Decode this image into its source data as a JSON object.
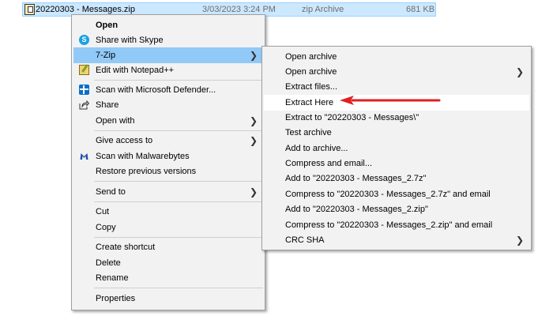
{
  "file": {
    "name": "20220303 - Messages.zip",
    "date": "3/03/2023 3:24 PM",
    "type": "zip Archive",
    "size": "681 KB"
  },
  "menu": {
    "open": "Open",
    "share_skype": "Share with Skype",
    "seven_zip": "7-Zip",
    "edit_notepad": "Edit with Notepad++",
    "scan_defender": "Scan with Microsoft Defender...",
    "share": "Share",
    "open_with": "Open with",
    "give_access": "Give access to",
    "scan_malwarebytes": "Scan with Malwarebytes",
    "restore_versions": "Restore previous versions",
    "send_to": "Send to",
    "cut": "Cut",
    "copy": "Copy",
    "create_shortcut": "Create shortcut",
    "delete": "Delete",
    "rename": "Rename",
    "properties": "Properties"
  },
  "submenu": {
    "open_archive": "Open archive",
    "open_archive_more": "Open archive",
    "extract_files": "Extract files...",
    "extract_here": "Extract Here",
    "extract_to": "Extract to \"20220303 - Messages\\\"",
    "test_archive": "Test archive",
    "add_to_archive": "Add to archive...",
    "compress_email": "Compress and email...",
    "add_7z": "Add to \"20220303 - Messages_2.7z\"",
    "compress_7z_email": "Compress to \"20220303 - Messages_2.7z\" and email",
    "add_zip": "Add to \"20220303 - Messages_2.zip\"",
    "compress_zip_email": "Compress to \"20220303 - Messages_2.zip\" and email",
    "crc_sha": "CRC SHA"
  },
  "icons": {
    "skype": "skype-icon",
    "notepad": "notepad-plus-plus-icon",
    "defender": "defender-icon",
    "share": "share-icon",
    "malwarebytes": "malwarebytes-icon",
    "submenu_arrow": "chevron-right-icon",
    "annotation": "red-arrow-icon"
  },
  "colors": {
    "highlight": "#91c9f7",
    "file_selected": "#cce8ff",
    "annotation_arrow": "#e02020"
  }
}
